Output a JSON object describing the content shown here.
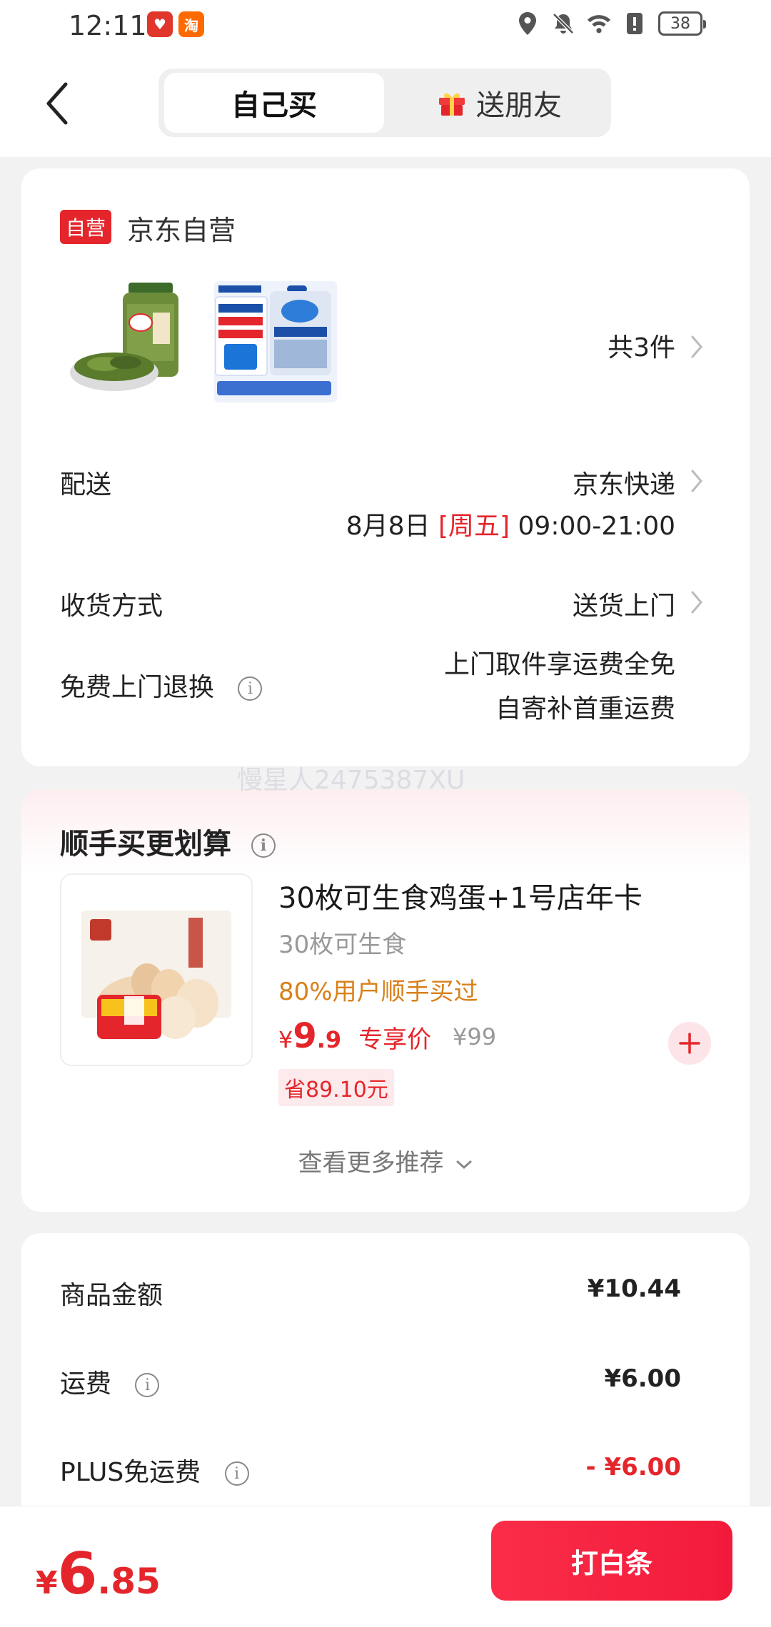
{
  "status_bar": {
    "time": "12:11",
    "battery": "38"
  },
  "header": {
    "tabs": [
      {
        "label": "自己买"
      },
      {
        "label": "送朋友"
      }
    ]
  },
  "order": {
    "self_badge": "自营",
    "shop_name": "京东自营",
    "item_count": "共3件",
    "delivery": {
      "label": "配送",
      "carrier": "京东快递",
      "date": "8月8日",
      "weekday": "[周五]",
      "time": "09:00-21:00"
    },
    "receive": {
      "label": "收货方式",
      "value": "送货上门"
    },
    "returns": {
      "label": "免费上门退换",
      "line1": "上门取件享运费全免",
      "line2": "自寄补首重运费"
    }
  },
  "watermark": "慢星人2475387XU",
  "recommend": {
    "title": "顺手买更划算",
    "item": {
      "name": "30枚可生食鸡蛋+1号店年卡",
      "subtitle": "30枚可生食",
      "bought": "80%用户顺手买过",
      "price_currency": "¥",
      "price_int": "9",
      "price_dec": ".9",
      "price_tag": "专享价",
      "original_price": "¥99",
      "save": "省89.10元"
    },
    "more": "查看更多推荐"
  },
  "summary": {
    "rows": [
      {
        "label": "商品金额",
        "value": "¥10.44"
      },
      {
        "label": "运费",
        "value": "¥6.00"
      },
      {
        "label": "PLUS免运费",
        "value": "- ¥6.00"
      }
    ]
  },
  "bottom": {
    "currency": "¥",
    "total_int": "6",
    "total_dec": ".85",
    "pay_label": "打白条"
  },
  "colors": {
    "accent": "#e4262c",
    "orange": "#d9801a",
    "background": "#f2f2f2"
  }
}
